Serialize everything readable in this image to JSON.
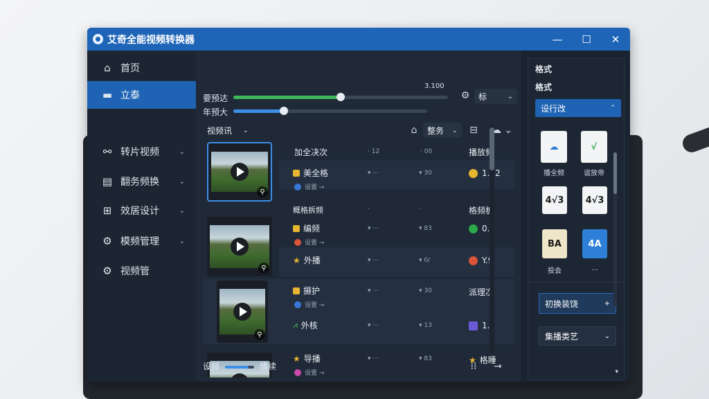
{
  "app": {
    "title": "艾奇全能视频转换器"
  },
  "window_controls": {
    "minimize": "—",
    "maximize": "☐",
    "close": "✕"
  },
  "sidebar": {
    "items": [
      {
        "label": "首页",
        "icon": "home-icon",
        "glyph": "⌂",
        "active": false
      },
      {
        "label": "立泰",
        "icon": "monitor-icon",
        "glyph": "▬",
        "active": true
      },
      {
        "label": "转片视频",
        "icon": "nodes-icon",
        "glyph": "⚯",
        "active": false
      },
      {
        "label": "翻务频换",
        "icon": "document-icon",
        "glyph": "▤",
        "active": false
      },
      {
        "label": "效居设计",
        "icon": "grid-icon",
        "glyph": "⊞",
        "active": false
      },
      {
        "label": "模频管理",
        "icon": "gear-icon",
        "glyph": "⚙",
        "active": false
      },
      {
        "label": "视频管",
        "icon": "settings-icon",
        "glyph": "⚙",
        "active": false
      }
    ]
  },
  "main": {
    "slider1": {
      "label": "要预达",
      "value_text": "3.100",
      "fraction": 0.5
    },
    "slider2": {
      "label": "年预大",
      "fraction": 0.26
    },
    "quality_select": {
      "label": "标"
    },
    "view_select": {
      "label": "视频讯"
    },
    "sort_select": {
      "label": "整务"
    },
    "list": {
      "header": {
        "name": "加全决次",
        "col1": "· 12",
        "col2": "· 00",
        "col3": "播放频"
      },
      "rows": [
        {
          "name": "美全格",
          "sub": "设置 →",
          "dot_color": "#3a78d8",
          "icon_color": "#e8b530",
          "col1": "▾ ⋯",
          "col2": "▾ 30",
          "status": "1.22",
          "status_color": "#e8b530"
        },
        {
          "name": "概格拆频",
          "col1": "·",
          "col2": "·",
          "status": "格频板"
        },
        {
          "name": "编频",
          "sub": "设置 →",
          "dot_color": "#d8553a",
          "icon_color": "#e8b530",
          "col1": "▾ ⋯",
          "col2": "▾ 83",
          "status": "0.5",
          "status_color": "#2ba84a"
        },
        {
          "name": "外播",
          "col1": "▾ ⋯",
          "col2": "▾ 0/",
          "status": "Y.9",
          "status_color": "#d8553a",
          "icon_color": "#e8b530"
        },
        {
          "name": "摄护",
          "sub": "设置 →",
          "dot_color": "#3a78d8",
          "icon_color": "#e8b530",
          "col1": "▾ ⋯",
          "col2": "▾ 30",
          "status": "派理次"
        },
        {
          "name": "外核",
          "col1": "▾ ⋯",
          "col2": "▾ 13",
          "status": "1.2",
          "status_color": "#6a5ad8",
          "icon_color": "#4fbf5a"
        },
        {
          "name": "导播",
          "sub": "设置 →",
          "dot_color": "#c84aa8",
          "icon_color": "#e8b530",
          "col1": "▾ ⋯",
          "col2": "▾ 83",
          "status": "格睡",
          "status_color": "#e8b530"
        }
      ]
    },
    "footer": {
      "left_label": "设频",
      "right_label": "情续"
    }
  },
  "right_panel": {
    "label1": "格式",
    "label2": "格式",
    "primary_button": "设行改",
    "formats": [
      {
        "glyph": "☁",
        "label": "播全频",
        "color": "#2d7fd8"
      },
      {
        "glyph": "√",
        "label": "谊放帝",
        "color": "#2ba84a"
      },
      {
        "glyph": "4√3",
        "label": "",
        "color": "#1a1a1a"
      },
      {
        "glyph": "4√3",
        "label": "",
        "color": "#1a1a1a"
      },
      {
        "glyph": "BA",
        "label": "投会",
        "color": "#1a1a1a"
      },
      {
        "glyph": "4A",
        "label": "...",
        "color": "#2d7fd8"
      }
    ],
    "action_button": "初换装饶",
    "bottom_select": "集播类艺"
  },
  "colors": {
    "accent": "#1e65b8",
    "titlebar": "#1e65b8",
    "slider_green": "#3cb85a",
    "slider_blue": "#3b8fe8"
  }
}
